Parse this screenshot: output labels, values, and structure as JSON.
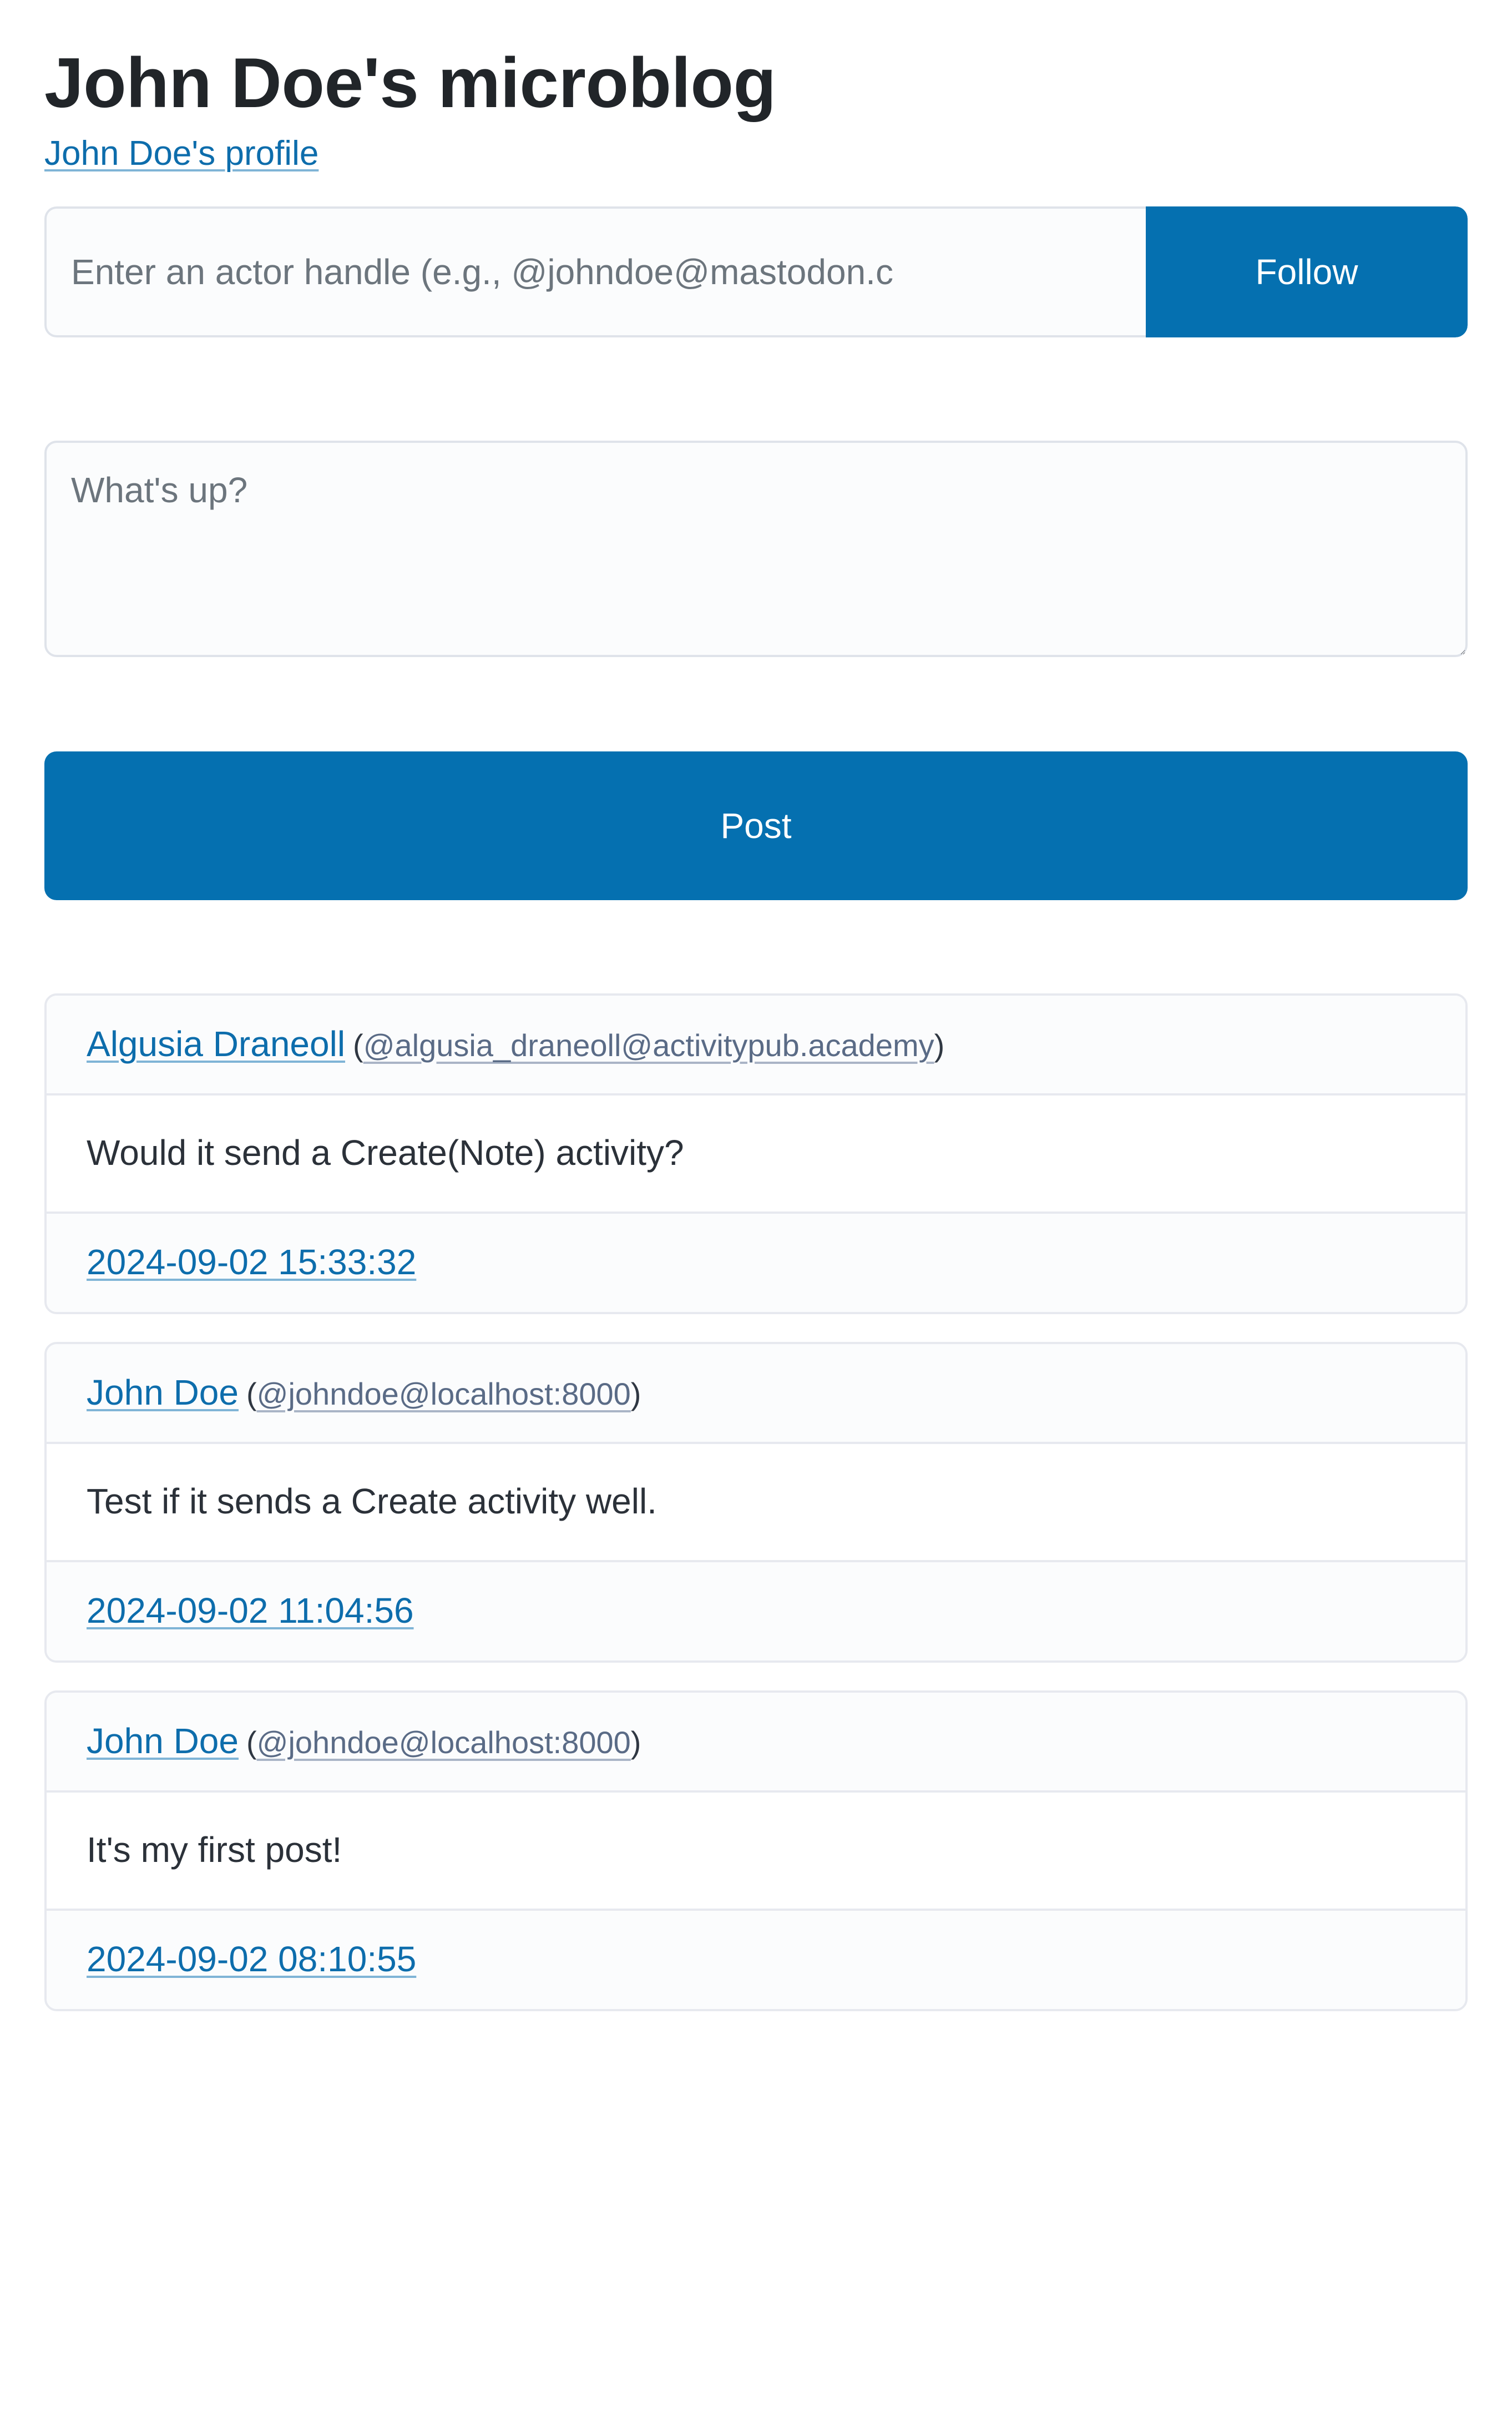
{
  "header": {
    "title": "John Doe's microblog",
    "profile_link": "John Doe's profile"
  },
  "follow_form": {
    "input_placeholder": "Enter an actor handle (e.g., @johndoe@mastodon.c",
    "input_value": "",
    "submit_label": "Follow"
  },
  "composer": {
    "placeholder": "What's up?",
    "value": "",
    "submit_label": "Post"
  },
  "colors": {
    "accent": "#0570b0",
    "link": "#0d6dac",
    "muted_link": "#5a6b86",
    "card_border": "#e7e9ef",
    "card_header_bg": "#fbfcfd",
    "card_body_bg": "#ffffff",
    "text": "#212529"
  },
  "feed": {
    "posts": [
      {
        "author_name": "Algusia Draneoll",
        "handle_open_paren": "(",
        "handle": "@algusia_draneoll@activitypub.academy",
        "handle_close_paren": ")",
        "content": "Would it send a Create(Note) activity?",
        "timestamp": "2024-09-02 15:33:32"
      },
      {
        "author_name": "John Doe",
        "handle_open_paren": "(",
        "handle": "@johndoe@localhost:8000",
        "handle_close_paren": ")",
        "content": "Test if it sends a Create activity well.",
        "timestamp": "2024-09-02 11:04:56"
      },
      {
        "author_name": "John Doe",
        "handle_open_paren": "(",
        "handle": "@johndoe@localhost:8000",
        "handle_close_paren": ")",
        "content": "It's my first post!",
        "timestamp": "2024-09-02 08:10:55"
      }
    ]
  }
}
